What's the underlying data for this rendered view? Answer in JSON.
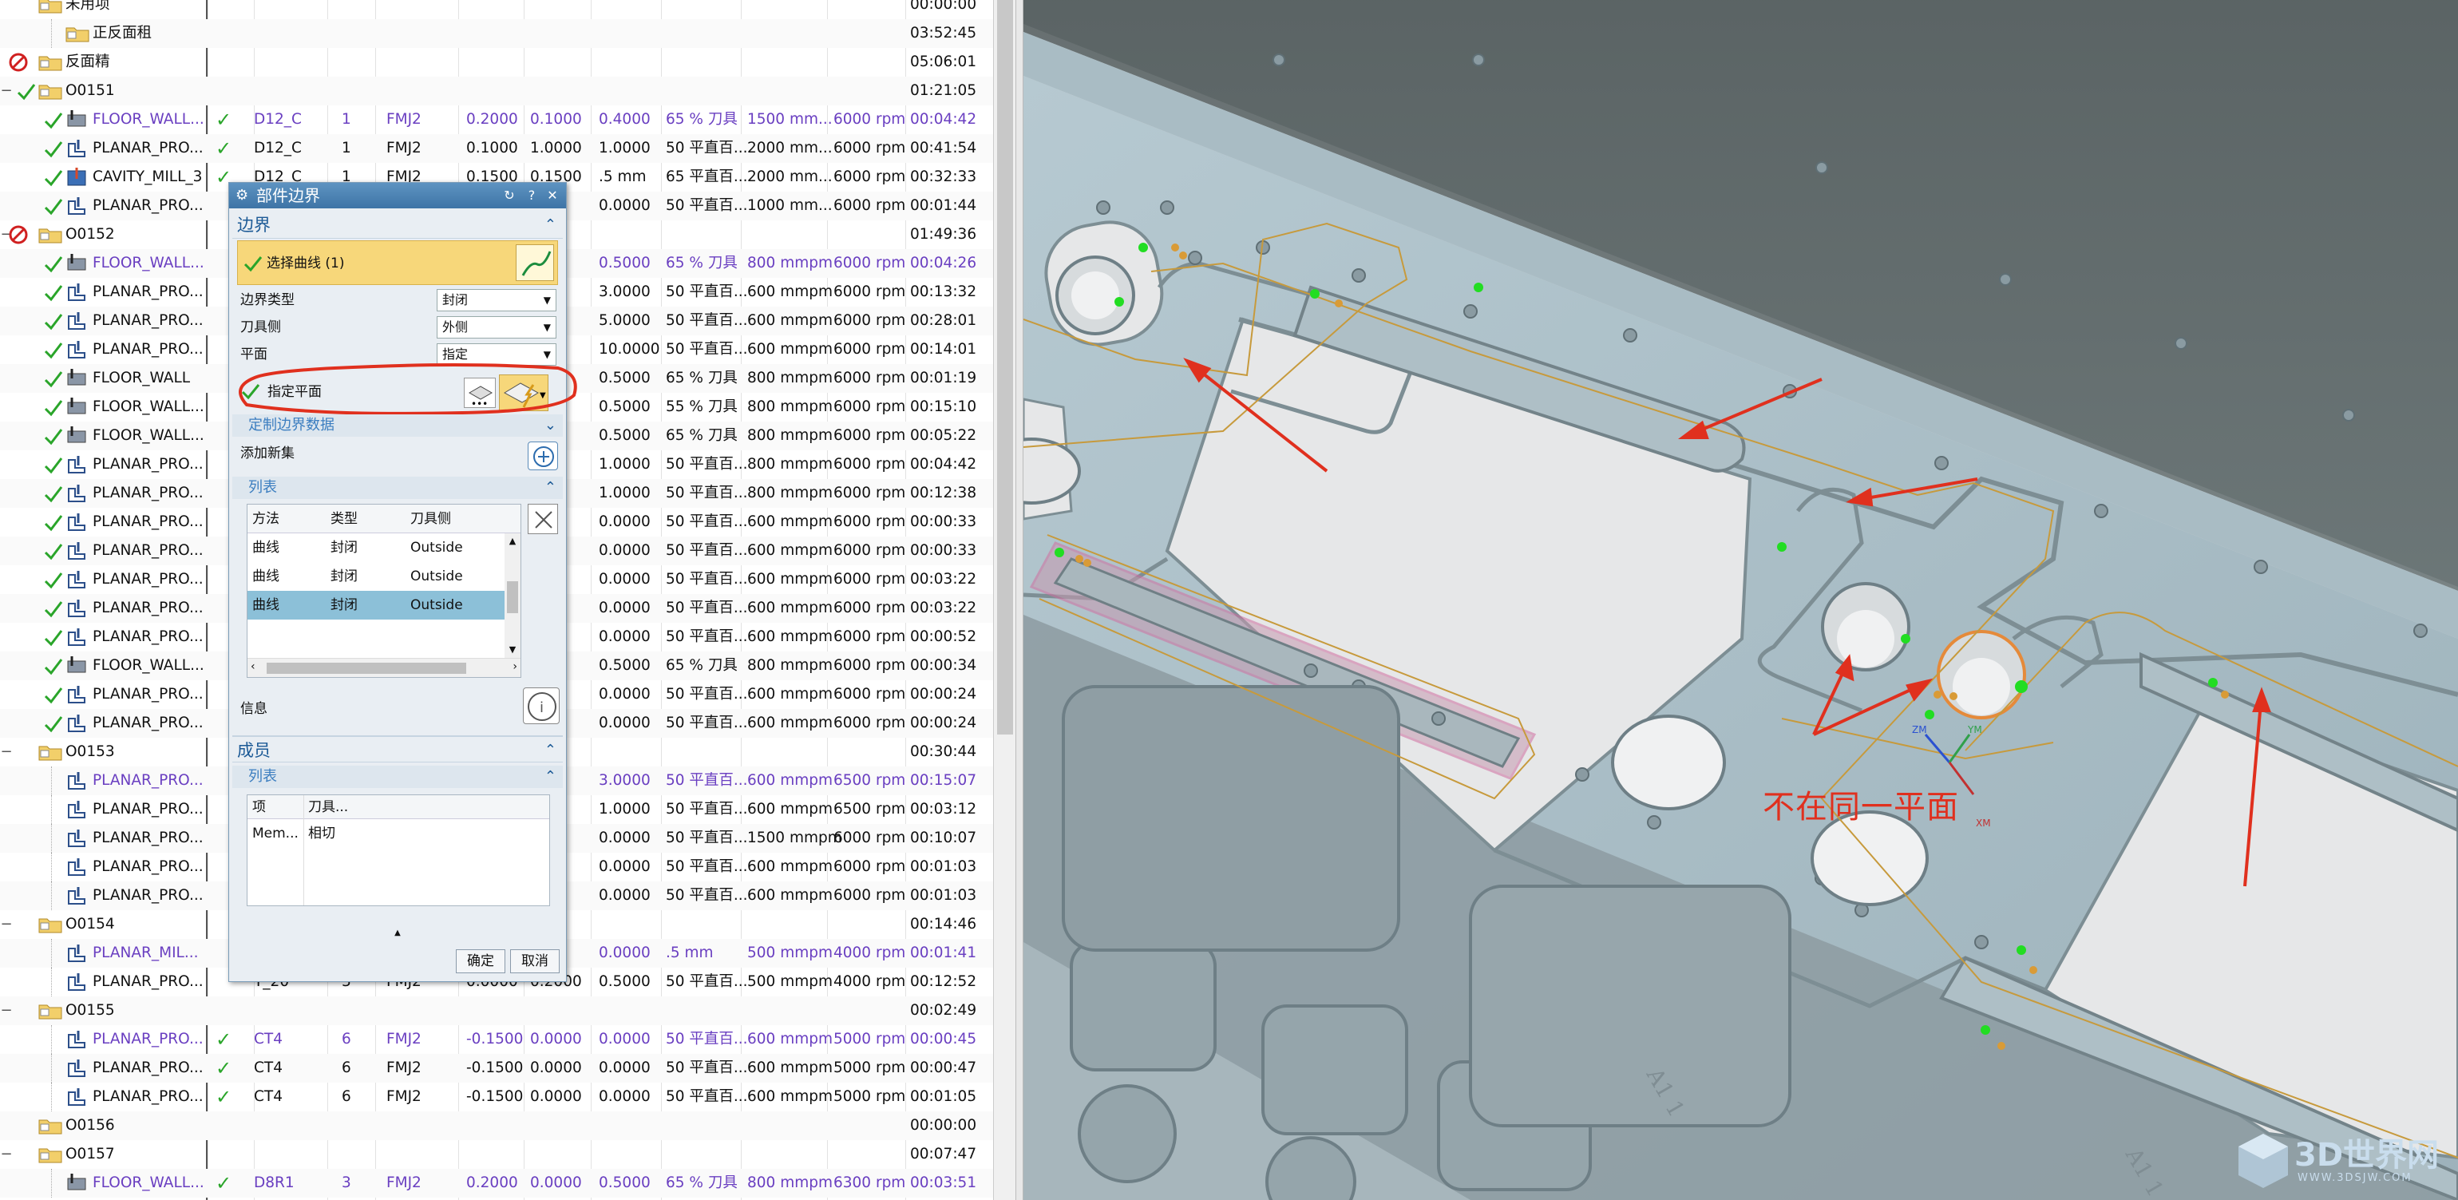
{
  "navigator": {
    "columns_note": "",
    "rows": [
      {
        "indent": 0,
        "expander": "",
        "status": "",
        "icon": "folder",
        "name": "未用项",
        "cols": [
          "",
          "",
          "",
          "",
          "",
          "",
          "",
          "",
          "",
          ""
        ],
        "time": "00:00:00"
      },
      {
        "indent": 1,
        "expander": "",
        "status": "",
        "icon": "folder",
        "name": "正反面租",
        "cols": [
          "",
          "",
          "",
          "",
          "",
          "",
          "",
          "",
          "",
          ""
        ],
        "time": "03:52:45"
      },
      {
        "indent": 0,
        "expander": "",
        "status": "no",
        "icon": "folder",
        "name": "反面精",
        "cols": [
          "",
          "",
          "",
          "",
          "",
          "",
          "",
          "",
          "",
          ""
        ],
        "time": "05:06:01"
      },
      {
        "indent": 0,
        "expander": "−",
        "status": "check",
        "icon": "folder",
        "name": "O0151",
        "cols": [
          "",
          "",
          "",
          "",
          "",
          "",
          "",
          "",
          "",
          ""
        ],
        "time": "01:21:05"
      },
      {
        "indent": 1,
        "expander": "",
        "status": "check",
        "icon": "floor",
        "name": "FLOOR_WALL...",
        "purple": true,
        "mark": "✓",
        "cols": [
          "D12_C",
          "1",
          "FMJ2",
          "0.2000",
          "0.1000",
          "0.4000",
          "65 % 刀具",
          "1500 mm...",
          "6000 rpm"
        ],
        "time": "00:04:42"
      },
      {
        "indent": 1,
        "expander": "",
        "status": "check",
        "icon": "planar",
        "name": "PLANAR_PRO...",
        "mark": "✓",
        "cols": [
          "D12_C",
          "1",
          "FMJ2",
          "0.1000",
          "1.0000",
          "1.0000",
          "50 平直百...",
          "2000 mm...",
          "6000 rpm"
        ],
        "time": "00:41:54"
      },
      {
        "indent": 1,
        "expander": "",
        "status": "check",
        "icon": "cavity",
        "name": "CAVITY_MILL_3",
        "mark": "✓",
        "cols": [
          "D12_C",
          "1",
          "FMJ2",
          "0.1500",
          "0.1500",
          ".5 mm",
          "65 平直百...",
          "2000 mm...",
          "6000 rpm"
        ],
        "time": "00:32:33"
      },
      {
        "indent": 1,
        "expander": "",
        "status": "check",
        "icon": "planar",
        "name": "PLANAR_PRO...",
        "mark": "",
        "cols": [
          "",
          "",
          "",
          "",
          "",
          "0.0000",
          "50 平直百...",
          "1000 mm...",
          "6000 rpm"
        ],
        "time": "00:01:44"
      },
      {
        "indent": 0,
        "expander": "−",
        "status": "no",
        "icon": "folder",
        "name": "O0152",
        "cols": [
          "",
          "",
          "",
          "",
          "",
          "",
          "",
          "",
          "",
          ""
        ],
        "time": "01:49:36"
      },
      {
        "indent": 1,
        "expander": "",
        "status": "check",
        "icon": "floor",
        "name": "FLOOR_WALL...",
        "purple": true,
        "mark": "",
        "cols": [
          "",
          "",
          "",
          "",
          "",
          "0.5000",
          "65 % 刀具",
          "800 mmpm",
          "6000 rpm"
        ],
        "time": "00:04:26"
      },
      {
        "indent": 1,
        "expander": "",
        "status": "check",
        "icon": "planar",
        "name": "PLANAR_PRO...",
        "mark": "",
        "cols": [
          "",
          "",
          "",
          "",
          "",
          "3.0000",
          "50 平直百...",
          "600 mmpm",
          "6000 rpm"
        ],
        "time": "00:13:32"
      },
      {
        "indent": 1,
        "expander": "",
        "status": "check",
        "icon": "planar",
        "name": "PLANAR_PRO...",
        "mark": "",
        "cols": [
          "",
          "",
          "",
          "",
          "",
          "5.0000",
          "50 平直百...",
          "600 mmpm",
          "6000 rpm"
        ],
        "time": "00:28:01"
      },
      {
        "indent": 1,
        "expander": "",
        "status": "check",
        "icon": "planar",
        "name": "PLANAR_PRO...",
        "mark": "",
        "cols": [
          "",
          "",
          "",
          "",
          "",
          "10.0000",
          "50 平直百...",
          "600 mmpm",
          "6000 rpm"
        ],
        "time": "00:14:01"
      },
      {
        "indent": 1,
        "expander": "",
        "status": "check",
        "icon": "floor",
        "name": "FLOOR_WALL",
        "mark": "",
        "cols": [
          "",
          "",
          "",
          "",
          "",
          "0.5000",
          "65 % 刀具",
          "800 mmpm",
          "6000 rpm"
        ],
        "time": "00:01:19"
      },
      {
        "indent": 1,
        "expander": "",
        "status": "check",
        "icon": "floor",
        "name": "FLOOR_WALL...",
        "mark": "",
        "cols": [
          "",
          "",
          "",
          "",
          "",
          "0.5000",
          "55 % 刀具",
          "800 mmpm",
          "6000 rpm"
        ],
        "time": "00:15:10"
      },
      {
        "indent": 1,
        "expander": "",
        "status": "check",
        "icon": "floor",
        "name": "FLOOR_WALL...",
        "mark": "",
        "cols": [
          "",
          "",
          "",
          "",
          "",
          "0.5000",
          "65 % 刀具",
          "800 mmpm",
          "6000 rpm"
        ],
        "time": "00:05:22"
      },
      {
        "indent": 1,
        "expander": "",
        "status": "check",
        "icon": "planar",
        "name": "PLANAR_PRO...",
        "mark": "",
        "cols": [
          "",
          "",
          "",
          "",
          "",
          "1.0000",
          "50 平直百...",
          "800 mmpm",
          "6000 rpm"
        ],
        "time": "00:04:42"
      },
      {
        "indent": 1,
        "expander": "",
        "status": "check",
        "icon": "planar",
        "name": "PLANAR_PRO...",
        "mark": "",
        "cols": [
          "",
          "",
          "",
          "",
          "",
          "1.0000",
          "50 平直百...",
          "800 mmpm",
          "6000 rpm"
        ],
        "time": "00:12:38"
      },
      {
        "indent": 1,
        "expander": "",
        "status": "check",
        "icon": "planar",
        "name": "PLANAR_PRO...",
        "mark": "",
        "cols": [
          "",
          "",
          "",
          "",
          "",
          "0.0000",
          "50 平直百...",
          "600 mmpm",
          "6000 rpm"
        ],
        "time": "00:00:33"
      },
      {
        "indent": 1,
        "expander": "",
        "status": "check",
        "icon": "planar",
        "name": "PLANAR_PRO...",
        "mark": "",
        "cols": [
          "",
          "",
          "",
          "",
          "",
          "0.0000",
          "50 平直百...",
          "600 mmpm",
          "6000 rpm"
        ],
        "time": "00:00:33"
      },
      {
        "indent": 1,
        "expander": "",
        "status": "check",
        "icon": "planar",
        "name": "PLANAR_PRO...",
        "mark": "",
        "cols": [
          "",
          "",
          "",
          "",
          "",
          "0.0000",
          "50 平直百...",
          "600 mmpm",
          "6000 rpm"
        ],
        "time": "00:03:22"
      },
      {
        "indent": 1,
        "expander": "",
        "status": "check",
        "icon": "planar",
        "name": "PLANAR_PRO...",
        "mark": "",
        "cols": [
          "",
          "",
          "",
          "",
          "",
          "0.0000",
          "50 平直百...",
          "600 mmpm",
          "6000 rpm"
        ],
        "time": "00:03:22"
      },
      {
        "indent": 1,
        "expander": "",
        "status": "check",
        "icon": "planar",
        "name": "PLANAR_PRO...",
        "mark": "",
        "cols": [
          "",
          "",
          "",
          "",
          "",
          "0.0000",
          "50 平直百...",
          "600 mmpm",
          "6000 rpm"
        ],
        "time": "00:00:52"
      },
      {
        "indent": 1,
        "expander": "",
        "status": "check",
        "icon": "floor",
        "name": "FLOOR_WALL...",
        "mark": "",
        "cols": [
          "",
          "",
          "",
          "",
          "",
          "0.5000",
          "65 % 刀具",
          "800 mmpm",
          "6000 rpm"
        ],
        "time": "00:00:34"
      },
      {
        "indent": 1,
        "expander": "",
        "status": "check",
        "icon": "planar",
        "name": "PLANAR_PRO...",
        "mark": "",
        "cols": [
          "",
          "",
          "",
          "",
          "",
          "0.0000",
          "50 平直百...",
          "600 mmpm",
          "6000 rpm"
        ],
        "time": "00:00:24"
      },
      {
        "indent": 1,
        "expander": "",
        "status": "check",
        "icon": "planar",
        "name": "PLANAR_PRO...",
        "mark": "",
        "cols": [
          "",
          "",
          "",
          "",
          "",
          "0.0000",
          "50 平直百...",
          "600 mmpm",
          "6000 rpm"
        ],
        "time": "00:00:24"
      },
      {
        "indent": 0,
        "expander": "−",
        "status": "",
        "icon": "folder",
        "name": "O0153",
        "cols": [
          "",
          "",
          "",
          "",
          "",
          "",
          "",
          "",
          "",
          ""
        ],
        "time": "00:30:44"
      },
      {
        "indent": 1,
        "expander": "",
        "status": "",
        "icon": "planar",
        "name": "PLANAR_PRO...",
        "purple": true,
        "mark": "",
        "cols": [
          "",
          "",
          "",
          "",
          "",
          "3.0000",
          "50 平直百...",
          "600 mmpm",
          "6500 rpm"
        ],
        "time": "00:15:07"
      },
      {
        "indent": 1,
        "expander": "",
        "status": "",
        "icon": "planar",
        "name": "PLANAR_PRO...",
        "mark": "",
        "cols": [
          "",
          "",
          "",
          "",
          "",
          "1.0000",
          "50 平直百...",
          "600 mmpm",
          "6500 rpm"
        ],
        "time": "00:03:12"
      },
      {
        "indent": 1,
        "expander": "",
        "status": "",
        "icon": "planar",
        "name": "PLANAR_PRO...",
        "mark": "",
        "cols": [
          "",
          "",
          "",
          "",
          "",
          "0.0000",
          "50 平直百...",
          "1500 mmpm",
          "6000 rpm"
        ],
        "time": "00:10:07"
      },
      {
        "indent": 1,
        "expander": "",
        "status": "",
        "icon": "planar",
        "name": "PLANAR_PRO...",
        "mark": "",
        "cols": [
          "",
          "",
          "",
          "",
          "",
          "0.0000",
          "50 平直百...",
          "600 mmpm",
          "6000 rpm"
        ],
        "time": "00:01:03"
      },
      {
        "indent": 1,
        "expander": "",
        "status": "",
        "icon": "planar",
        "name": "PLANAR_PRO...",
        "mark": "",
        "cols": [
          "",
          "",
          "",
          "",
          "",
          "0.0000",
          "50 平直百...",
          "600 mmpm",
          "6000 rpm"
        ],
        "time": "00:01:03"
      },
      {
        "indent": 0,
        "expander": "−",
        "status": "",
        "icon": "folder",
        "name": "O0154",
        "cols": [
          "",
          "",
          "",
          "",
          "",
          "",
          "",
          "",
          "",
          ""
        ],
        "time": "00:14:46"
      },
      {
        "indent": 1,
        "expander": "",
        "status": "",
        "icon": "planar",
        "name": "PLANAR_MIL...",
        "purple": true,
        "mark": "",
        "cols": [
          "",
          "",
          "",
          "",
          "",
          "0.0000",
          ".5 mm",
          "500 mmpm",
          "4000 rpm"
        ],
        "time": "00:01:41"
      },
      {
        "indent": 1,
        "expander": "",
        "status": "",
        "icon": "planar",
        "name": "PLANAR_PRO...",
        "mark": "",
        "cols": [
          "T_20",
          "3",
          "FMJ2",
          "0.0000",
          "0.2000",
          "0.5000",
          "50 平直百...",
          "500 mmpm",
          "4000 rpm"
        ],
        "time": "00:12:52"
      },
      {
        "indent": 0,
        "expander": "−",
        "status": "",
        "icon": "folder",
        "name": "O0155",
        "cols": [
          "",
          "",
          "",
          "",
          "",
          "",
          "",
          "",
          "",
          ""
        ],
        "time": "00:02:49"
      },
      {
        "indent": 1,
        "expander": "",
        "status": "",
        "icon": "planar",
        "name": "PLANAR_PRO...",
        "purple": true,
        "mark": "✓",
        "cols": [
          "CT4",
          "6",
          "FMJ2",
          "-0.1500",
          "0.0000",
          "0.0000",
          "50 平直百...",
          "600 mmpm",
          "5000 rpm"
        ],
        "time": "00:00:45"
      },
      {
        "indent": 1,
        "expander": "",
        "status": "",
        "icon": "planar",
        "name": "PLANAR_PRO...",
        "mark": "✓",
        "cols": [
          "CT4",
          "6",
          "FMJ2",
          "-0.1500",
          "0.0000",
          "0.0000",
          "50 平直百...",
          "600 mmpm",
          "5000 rpm"
        ],
        "time": "00:00:47"
      },
      {
        "indent": 1,
        "expander": "",
        "status": "",
        "icon": "planar",
        "name": "PLANAR_PRO...",
        "mark": "✓",
        "cols": [
          "CT4",
          "6",
          "FMJ2",
          "-0.1500",
          "0.0000",
          "0.0000",
          "50 平直百...",
          "600 mmpm",
          "5000 rpm"
        ],
        "time": "00:01:05"
      },
      {
        "indent": 0,
        "expander": "",
        "status": "",
        "icon": "folder",
        "name": "O0156",
        "cols": [
          "",
          "",
          "",
          "",
          "",
          "",
          "",
          "",
          "",
          ""
        ],
        "time": "00:00:00"
      },
      {
        "indent": 0,
        "expander": "−",
        "status": "",
        "icon": "folder",
        "name": "O0157",
        "cols": [
          "",
          "",
          "",
          "",
          "",
          "",
          "",
          "",
          "",
          ""
        ],
        "time": "00:07:47"
      },
      {
        "indent": 1,
        "expander": "",
        "status": "",
        "icon": "floor",
        "name": "FLOOR_WALL...",
        "purple": true,
        "mark": "✓",
        "cols": [
          "D8R1",
          "3",
          "FMJ2",
          "0.2000",
          "0.0000",
          "0.5000",
          "65 % 刀具",
          "800 mmpm",
          "6300 rpm"
        ],
        "time": "00:03:51"
      }
    ]
  },
  "dialog": {
    "title": "部件边界",
    "reset_icon": "reset-icon",
    "help_label": "?",
    "close_label": "✕",
    "boundary_header": "边界",
    "select_curve_label": "选择曲线 (1)",
    "boundary_type_label": "边界类型",
    "boundary_type_value": "封闭",
    "tool_side_label": "刀具侧",
    "tool_side_value": "外侧",
    "plane_label": "平面",
    "plane_value": "指定",
    "specify_plane_label": "指定平面",
    "custom_boundary_label": "定制边界数据",
    "add_new_set_label": "添加新集",
    "list_header": "列表",
    "list_columns": [
      "方法",
      "类型",
      "刀具侧"
    ],
    "list_rows": [
      {
        "method": "曲线",
        "type": "封闭",
        "side": "Outside"
      },
      {
        "method": "曲线",
        "type": "封闭",
        "side": "Outside"
      },
      {
        "method": "曲线",
        "type": "封闭",
        "side": "Outside"
      }
    ],
    "info_label": "信息",
    "members_header": "成员",
    "members_list_header": "列表",
    "members_columns": [
      "项",
      "刀具..."
    ],
    "members_rows": [
      {
        "item": "Mem...",
        "tool": "相切"
      }
    ],
    "ok_label": "确定",
    "cancel_label": "取消"
  },
  "annotation": {
    "text": "不在同一平面",
    "color": "#e0301e"
  },
  "viewport": {
    "axis_labels": [
      "ZM",
      "YM",
      "XM"
    ]
  },
  "watermark": {
    "brand": "3D世界网",
    "url": "WWW.3DSJW.COM"
  }
}
